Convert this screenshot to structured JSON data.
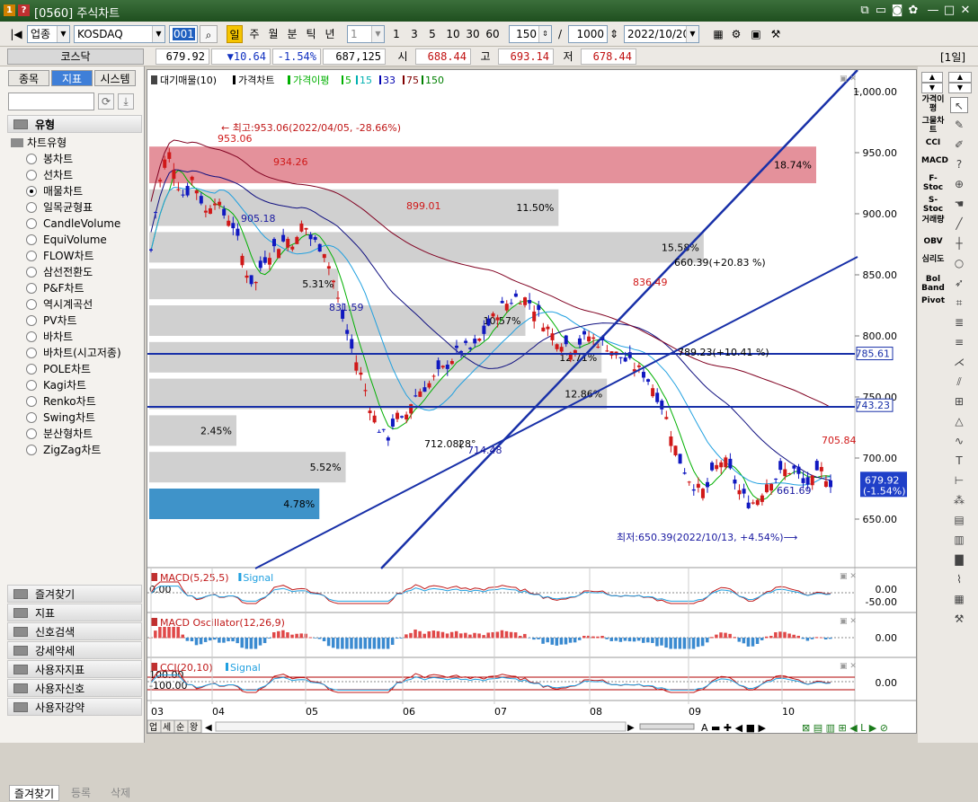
{
  "window": {
    "badge1": "1",
    "badge2": "?",
    "title": "[0560] 주식차트"
  },
  "toolbar": {
    "market_type": "업종",
    "index_name": "KOSDAQ",
    "code": "001",
    "periods": [
      "일",
      "주",
      "월",
      "분",
      "틱",
      "년"
    ],
    "interval_value": "1",
    "interval_buttons": [
      "1",
      "3",
      "5",
      "10",
      "30",
      "60"
    ],
    "count": "150",
    "separator": "/",
    "total": "1000",
    "date": "2022/10/20"
  },
  "quote": {
    "name": "코스닥",
    "price": "679.92",
    "change": "▼10.64",
    "change_pct": "-1.54%",
    "volume": "687,125",
    "open_label": "시",
    "open": "688.44",
    "high_label": "고",
    "high": "693.14",
    "low_label": "저",
    "low": "678.44",
    "period_badge": "[1일]"
  },
  "left_panel": {
    "tabs": [
      "종목",
      "지표",
      "시스템"
    ],
    "group_label": "유형",
    "tree_root": "차트유형",
    "chart_types": [
      "봉차트",
      "선차트",
      "매물차트",
      "일목균형표",
      "CandleVolume",
      "EquiVolume",
      "FLOW차트",
      "삼선전환도",
      "P&F차트",
      "역시계곡선",
      "PV차트",
      "바차트",
      "바차트(시고저종)",
      "POLE차트",
      "Kagi차트",
      "Renko차트",
      "Swing차트",
      "분산형차트",
      "ZigZag차트"
    ],
    "selected_index": 2,
    "sections": [
      "즐겨찾기",
      "지표",
      "신호검색",
      "강세약세",
      "사용자지표",
      "사용자신호",
      "사용자강약"
    ],
    "bottom_buttons": [
      "즐겨찾기",
      "등록",
      "삭제"
    ]
  },
  "chart_data": {
    "type": "candlestick",
    "legend": {
      "volume_profile": "대기매물(10)",
      "price": "가격차트",
      "ma_label": "가격이평",
      "ma_periods": [
        "5",
        "15",
        "33",
        "75",
        "150"
      ],
      "ma_colors": [
        "#00b000",
        "#00b0b0",
        "#0000b0",
        "#800000",
        "#008000"
      ]
    },
    "price_axis": [
      "1,000.00",
      "950.00",
      "900.00",
      "850.00",
      "800.00",
      "750.00",
      "700.00",
      "650.00"
    ],
    "ylim": [
      650,
      1000
    ],
    "month_labels": [
      "03",
      "04",
      "05",
      "06",
      "07",
      "08",
      "09",
      "10"
    ],
    "volume_profile": [
      {
        "label": "18.74%",
        "from": 925,
        "to": 955,
        "pct": 18.74,
        "highlight": true
      },
      {
        "label": "11.50%",
        "from": 890,
        "to": 920,
        "pct": 11.5
      },
      {
        "label": "15.58%",
        "from": 860,
        "to": 885,
        "pct": 15.58
      },
      {
        "label": "5.31%",
        "from": 830,
        "to": 855,
        "pct": 5.31
      },
      {
        "label": "10.57%",
        "from": 800,
        "to": 825,
        "pct": 10.57
      },
      {
        "label": "12.71%",
        "from": 770,
        "to": 795,
        "pct": 12.71
      },
      {
        "label": "12.86%",
        "from": 740,
        "to": 765,
        "pct": 12.86
      },
      {
        "label": "2.45%",
        "from": 710,
        "to": 735,
        "pct": 2.45
      },
      {
        "label": "5.52%",
        "from": 680,
        "to": 705,
        "pct": 5.52
      },
      {
        "label": "4.78%",
        "from": 650,
        "to": 675,
        "pct": 4.78,
        "current": true
      }
    ],
    "horizontal_lines": [
      "785.61",
      "743.23"
    ],
    "current_price_label": [
      "679.92",
      "(-1.54%)"
    ],
    "annotations": {
      "high": "← 최고:953.06(2022/04/05, -28.66%)",
      "low": "최저:650.39(2022/10/13, +4.54%)⟶",
      "peaks": [
        "953.06",
        "934.26",
        "899.01",
        "836.49",
        "705.84"
      ],
      "troughs": [
        "905.18",
        "831.59",
        "712.08(",
        "714.48",
        "661.69"
      ],
      "pct_labels": [
        "660.39(+20.83 %)",
        "789.23(+10.41 %)",
        "28°"
      ]
    },
    "indicators": [
      {
        "name": "MACD(5,25,5)",
        "signal": "Signal",
        "axis": [
          "0.00",
          "-50.00"
        ],
        "left_value": "0.00"
      },
      {
        "name": "MACD Oscillator(12,26,9)",
        "axis": [
          "0.00"
        ]
      },
      {
        "name": "CCI(20,10)",
        "signal": "Signal",
        "axis": [
          "0.00"
        ],
        "left_values": [
          "100.00",
          "-100.00"
        ]
      }
    ],
    "bottom_tabs": [
      "업",
      "세",
      "순",
      "왕"
    ]
  },
  "right_panel": {
    "indicators": [
      "가격이평",
      "그물차트",
      "CCI",
      "MACD",
      "F-Stoc",
      "S-Stoc",
      "거래량",
      "OBV",
      "심리도",
      "Bol Band",
      "Pivot"
    ]
  }
}
